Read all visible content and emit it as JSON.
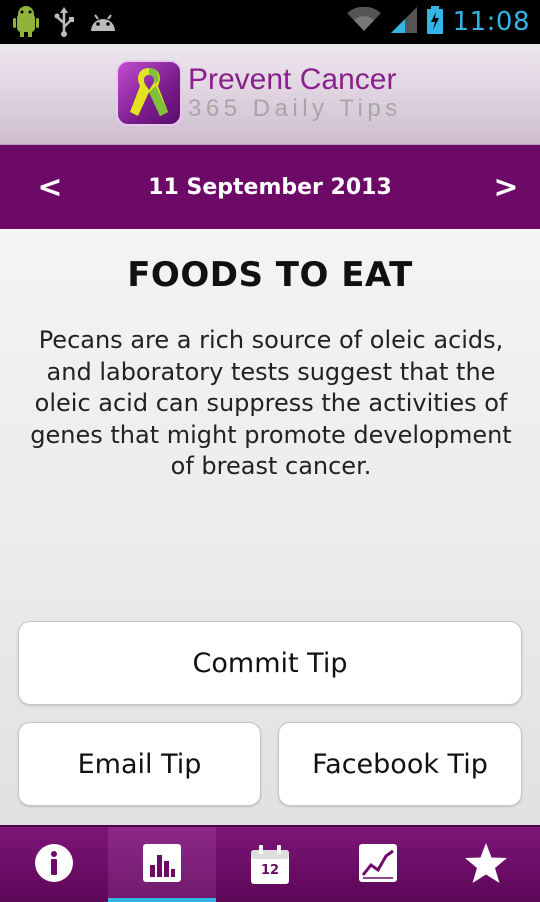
{
  "status_bar": {
    "time": "11:08",
    "left_icons": [
      "android-debug-icon",
      "usb-icon",
      "android-icon"
    ],
    "right_icons": [
      "wifi-icon",
      "signal-icon",
      "battery-charging-icon"
    ]
  },
  "header": {
    "logo_title": "Prevent Cancer",
    "logo_subtitle": "365 Daily Tips",
    "logo_icon": "ribbon-icon"
  },
  "date_nav": {
    "prev_label": "<",
    "date": "11 September 2013",
    "next_label": ">"
  },
  "tip": {
    "title": "FOODS TO EAT",
    "text": "Pecans are a rich source of oleic acids, and laboratory tests suggest that the oleic acid can suppress the activities of genes that might promote development of breast cancer."
  },
  "buttons": {
    "commit": "Commit Tip",
    "email": "Email Tip",
    "facebook": "Facebook Tip"
  },
  "bottom_nav": {
    "items": [
      {
        "icon": "info-icon",
        "active": false
      },
      {
        "icon": "bar-chart-icon",
        "active": true
      },
      {
        "icon": "calendar-icon",
        "active": false,
        "calendar_day": "12"
      },
      {
        "icon": "line-chart-icon",
        "active": false
      },
      {
        "icon": "star-icon",
        "active": false
      }
    ]
  },
  "colors": {
    "brand_purple": "#6d0a68",
    "status_accent": "#33b5e5",
    "ribbon_yellow": "#e2e51e",
    "ribbon_green": "#7ec23a"
  }
}
